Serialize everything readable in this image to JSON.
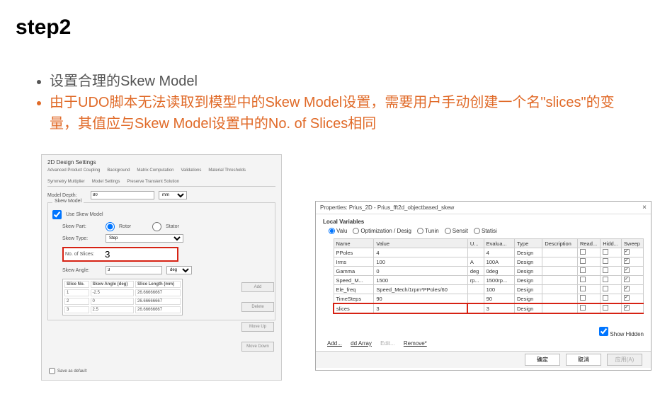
{
  "title": "step2",
  "bullets": {
    "b1": "设置合理的Skew Model",
    "b2": "由于UDO脚本无法读取到模型中的Skew Model设置，需要用户手动创建一个名\"slices\"的变量，其值应与Skew Model设置中的No. of Slices相同"
  },
  "left": {
    "header": "2D Design Settings",
    "tabs": [
      "Advanced Product Coupling",
      "Background",
      "Matrix Computation",
      "Validations",
      "Material Thresholds",
      "Symmetry Multiplier",
      "Model Settings",
      "Preserve Transient Solution"
    ],
    "model_depth_lbl": "Model Depth:",
    "model_depth_val": "80",
    "model_depth_unit": "mm",
    "group_legend": "Skew Model",
    "use_skew": "Use Skew Model",
    "skew_part_lbl": "Skew Part:",
    "skew_part_rotor": "Rotor",
    "skew_part_stator": "Stator",
    "skew_type_lbl": "Skew Type:",
    "skew_type_val": "Step",
    "no_slices_lbl": "No. of Slices:",
    "no_slices_val": "3",
    "skew_angle_lbl": "Skew Angle:",
    "skew_angle_val": "3",
    "skew_angle_unit": "deg",
    "tbl_hdr": [
      "Slice No.",
      "Skew Angle (deg)",
      "Slice Length (mm)"
    ],
    "tbl_rows": [
      [
        "1",
        "-2.5",
        "26.66666667"
      ],
      [
        "2",
        "0",
        "26.66666667"
      ],
      [
        "3",
        "2.5",
        "26.66666667"
      ]
    ],
    "btn_add": "Add",
    "btn_delete": "Delete",
    "btn_up": "Move Up",
    "btn_down": "Move Down",
    "save_default": "Save as default"
  },
  "right": {
    "title": "Properties: Prius_2D - Prius_fft2d_objectbased_skew",
    "local": "Local Variables",
    "radios": [
      "Valu",
      "Optimization / Desig",
      "Tunin",
      "Sensit",
      "Statisi"
    ],
    "hdr": [
      "Name",
      "Value",
      "U...",
      "Evalua...",
      "Type",
      "Description",
      "Read...",
      "Hidd...",
      "Sweep"
    ],
    "rows": [
      {
        "n": "PPoles",
        "v": "4",
        "u": "",
        "e": "4",
        "t": "Design",
        "ro": false,
        "hi": false,
        "sw": true
      },
      {
        "n": "Irms",
        "v": "100",
        "u": "A",
        "e": "100A",
        "t": "Design",
        "ro": false,
        "hi": false,
        "sw": true
      },
      {
        "n": "Gamma",
        "v": "0",
        "u": "deg",
        "e": "0deg",
        "t": "Design",
        "ro": false,
        "hi": false,
        "sw": true
      },
      {
        "n": "Speed_M...",
        "v": "1500",
        "u": "rp...",
        "e": "1500rp...",
        "t": "Design",
        "ro": false,
        "hi": false,
        "sw": true
      },
      {
        "n": "Ele_freq",
        "v": "Speed_Mech/1rpm*PPoles/60",
        "u": "",
        "e": "100",
        "t": "Design",
        "ro": false,
        "hi": false,
        "sw": true
      },
      {
        "n": "TimeSteps",
        "v": "90",
        "u": "",
        "e": "90",
        "t": "Design",
        "ro": false,
        "hi": false,
        "sw": true
      },
      {
        "n": "slices",
        "v": "3",
        "u": "",
        "e": "3",
        "t": "Design",
        "ro": false,
        "hi": false,
        "sw": true
      }
    ],
    "show_hidden": "Show Hidden",
    "btns": {
      "add": "Add...",
      "arr": "dd Array",
      "edit": "Edit...",
      "rem": "Remove*"
    },
    "ok": "确定",
    "cancel": "取消",
    "apply": "应用(A)"
  }
}
